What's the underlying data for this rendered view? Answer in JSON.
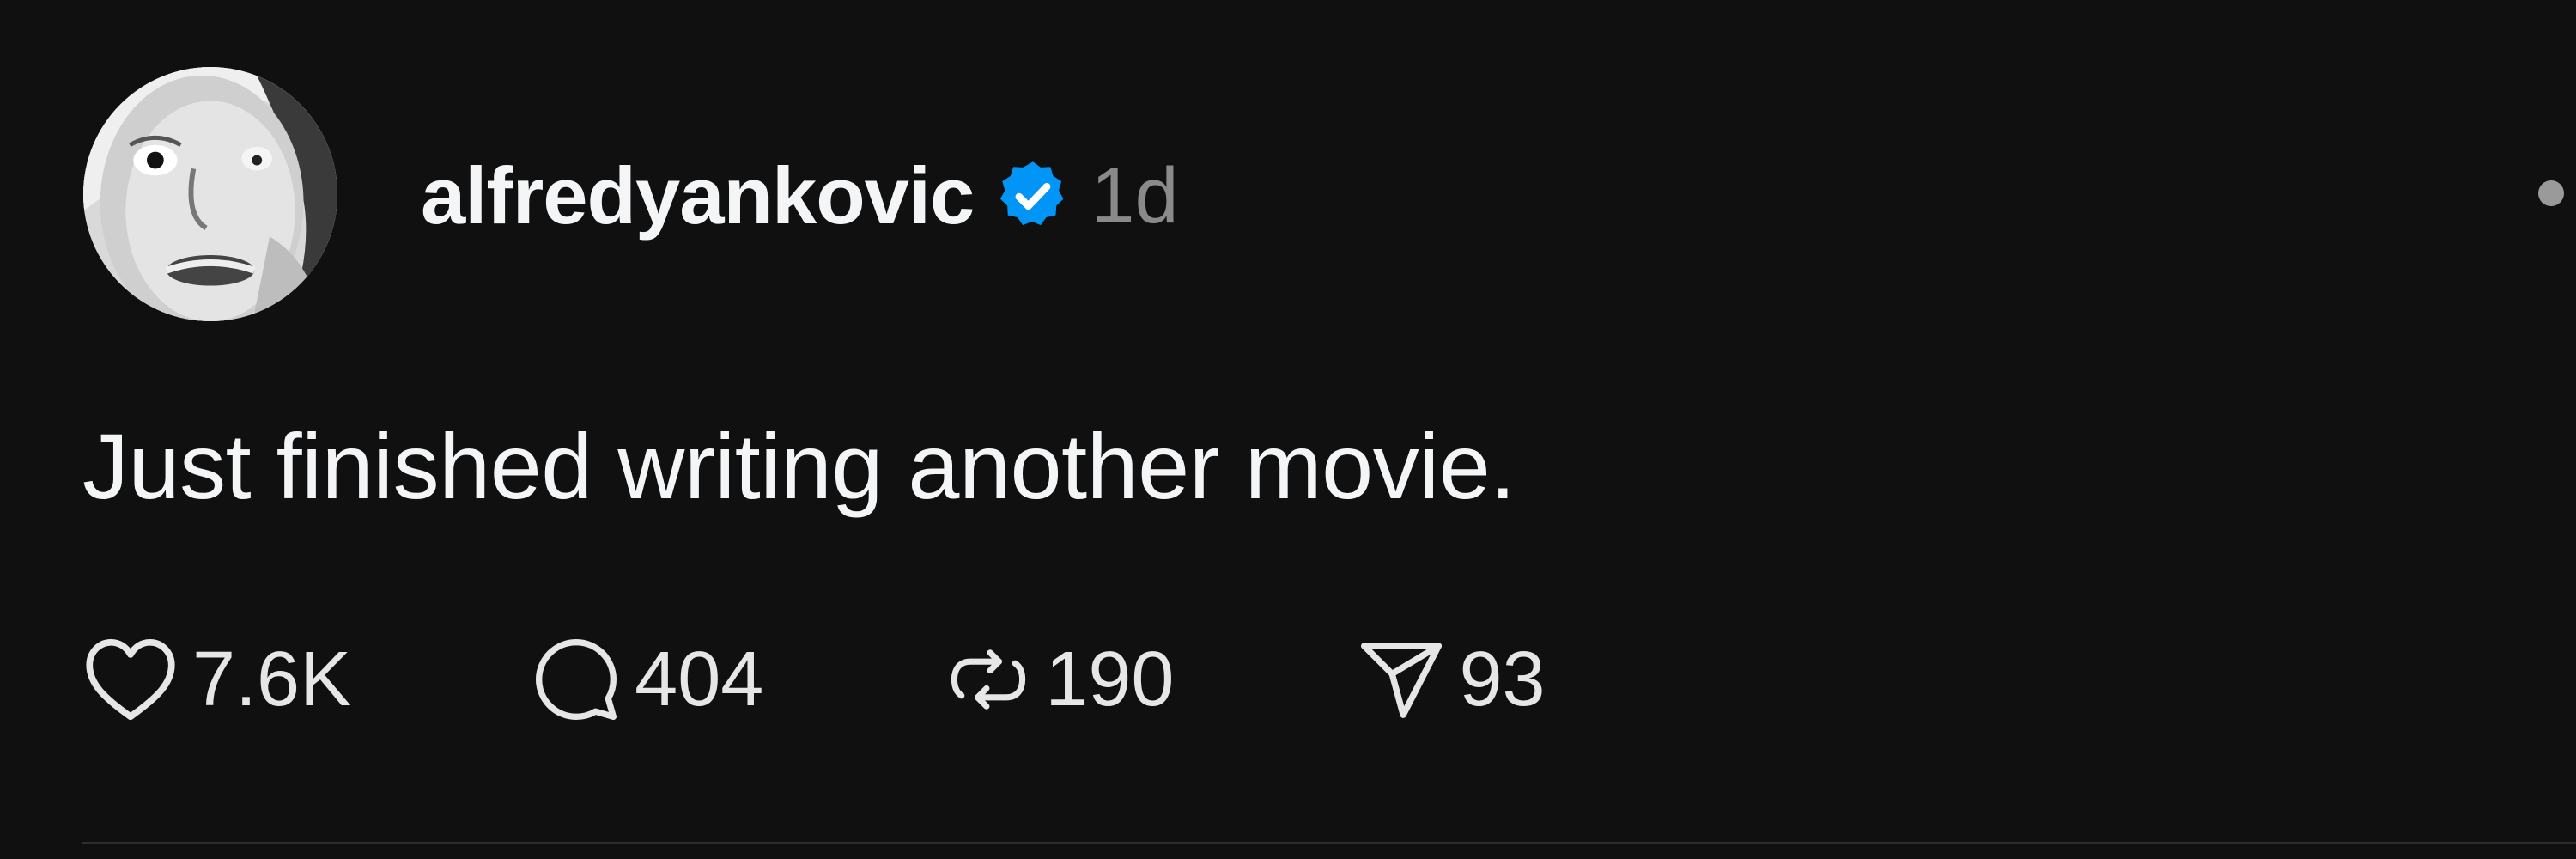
{
  "post": {
    "author": {
      "username": "alfredyankovic",
      "verified": true,
      "avatar_icon": "avatar-photo"
    },
    "time": "1d",
    "text": "Just finished writing another movie.",
    "actions": {
      "likes": "7.6K",
      "replies": "404",
      "reposts": "190",
      "shares": "93"
    },
    "icons": {
      "like": "heart-icon",
      "reply": "speech-bubble-icon",
      "repost": "repost-icon",
      "share": "paper-plane-icon",
      "verified": "verified-badge-icon",
      "more": "more-options-icon"
    }
  },
  "colors": {
    "background": "#101010",
    "text": "#f3f5f7",
    "muted": "#8a8a8a",
    "verified_blue": "#0095f6"
  }
}
